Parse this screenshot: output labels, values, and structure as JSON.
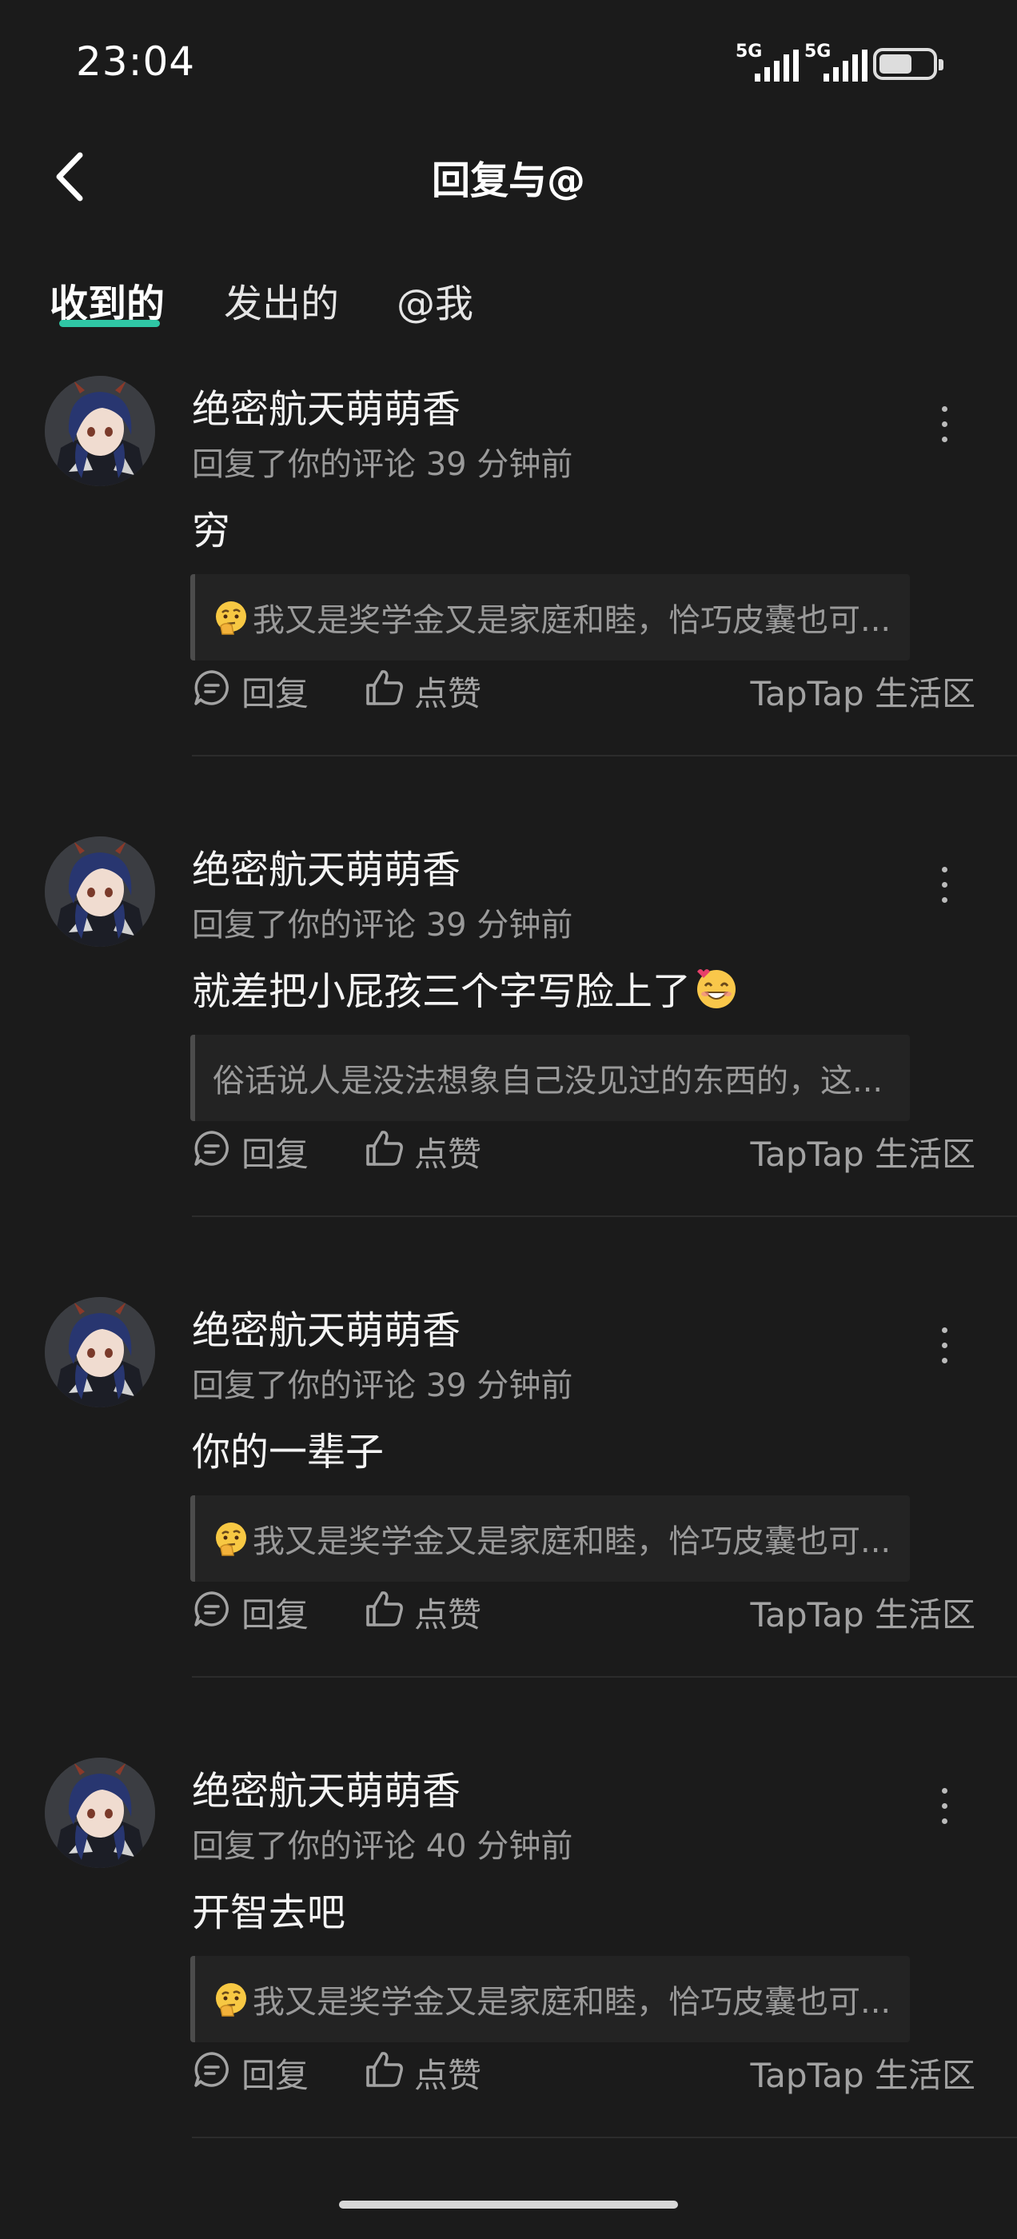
{
  "status_bar": {
    "time": "23:04",
    "signal_1": "5G",
    "signal_2": "5G",
    "battery_level": 0.6
  },
  "header": {
    "title": "回复与@"
  },
  "tabs": [
    {
      "label": "收到的",
      "active": true
    },
    {
      "label": "发出的",
      "active": false
    },
    {
      "label": "@我",
      "active": false
    }
  ],
  "colors": {
    "accent": "#2fc7a5",
    "background": "#1b1b1b"
  },
  "items": [
    {
      "username": "绝密航天萌萌香",
      "meta": "回复了你的评论 39 分钟前",
      "content": "穷",
      "content_emoji": "",
      "quote_emoji": "thinking-face",
      "quote": "我又是奖学金又是家庭和睦，恰巧皮囊也可...",
      "reply_label": "回复",
      "like_label": "点赞",
      "source": "TapTap 生活区"
    },
    {
      "username": "绝密航天萌萌香",
      "meta": "回复了你的评论 39 分钟前",
      "content": "就差把小屁孩三个字写脸上了",
      "content_emoji": "smiling-face",
      "quote_emoji": "",
      "quote": "俗话说人是没法想象自己没见过的东西的，这...",
      "reply_label": "回复",
      "like_label": "点赞",
      "source": "TapTap 生活区"
    },
    {
      "username": "绝密航天萌萌香",
      "meta": "回复了你的评论 39 分钟前",
      "content": "你的一辈子",
      "content_emoji": "",
      "quote_emoji": "thinking-face",
      "quote": "我又是奖学金又是家庭和睦，恰巧皮囊也可...",
      "reply_label": "回复",
      "like_label": "点赞",
      "source": "TapTap 生活区"
    },
    {
      "username": "绝密航天萌萌香",
      "meta": "回复了你的评论 40 分钟前",
      "content": "开智去吧",
      "content_emoji": "",
      "quote_emoji": "thinking-face",
      "quote": "我又是奖学金又是家庭和睦，恰巧皮囊也可...",
      "reply_label": "回复",
      "like_label": "点赞",
      "source": "TapTap 生活区"
    }
  ]
}
